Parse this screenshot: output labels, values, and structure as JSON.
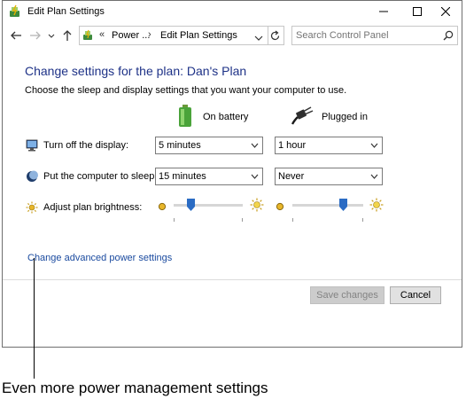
{
  "window": {
    "title": "Edit Plan Settings",
    "icons": {
      "app": "power-options-icon",
      "minimize": "minimize-icon",
      "maximize": "maximize-icon",
      "close": "close-icon"
    }
  },
  "nav": {
    "back_icon": "back-arrow-icon",
    "forward_icon": "forward-arrow-icon",
    "recent_icon": "recent-locations-chevron-icon",
    "up_icon": "up-arrow-icon",
    "address": {
      "icon": "control-panel-icon",
      "overflow": "«",
      "segments": [
        "Power ...",
        "Edit Plan Settings"
      ],
      "separator": "›"
    },
    "refresh_icon": "refresh-icon",
    "search": {
      "placeholder": "Search Control Panel",
      "value": "",
      "icon": "search-icon"
    }
  },
  "main": {
    "heading": "Change settings for the plan: Dan's Plan",
    "subtitle": "Choose the sleep and display settings that you want your computer to use.",
    "columns": [
      {
        "label": "On battery",
        "icon": "battery-icon"
      },
      {
        "label": "Plugged in",
        "icon": "power-plug-icon"
      }
    ],
    "rows": [
      {
        "label": "Turn off the display:",
        "icon": "monitor-icon",
        "battery_value": "5 minutes",
        "plugged_value": "1 hour"
      },
      {
        "label": "Put the computer to sleep:",
        "icon": "sleep-moon-icon",
        "battery_value": "15 minutes",
        "plugged_value": "Never"
      }
    ],
    "brightness": {
      "label": "Adjust plan brightness:",
      "icon": "brightness-sun-icon",
      "battery_level": 0.25,
      "plugged_level": 0.72
    },
    "advanced_link": "Change advanced power settings"
  },
  "buttons": {
    "save": "Save changes",
    "cancel": "Cancel"
  },
  "annotation": {
    "caption": "Even more power management settings"
  },
  "colors": {
    "heading": "#1e3287",
    "link": "#1a4a9f",
    "thumb": "#2b6cc4"
  }
}
